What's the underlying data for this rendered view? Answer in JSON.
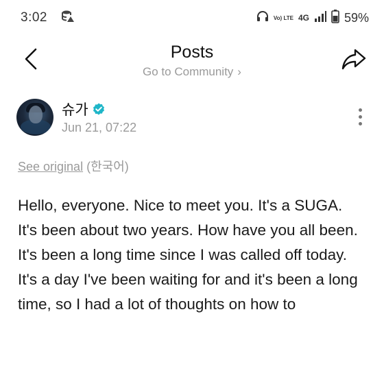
{
  "status_bar": {
    "time": "3:02",
    "volte": "Vo) LTE",
    "network": "4G",
    "battery": "59%"
  },
  "header": {
    "title": "Posts",
    "community_link": "Go to Community",
    "community_chevron": "›"
  },
  "author": {
    "name": "슈가",
    "time": "Jun 21, 07:22"
  },
  "translation": {
    "see_original": "See original",
    "language": "(한국어)"
  },
  "post": {
    "lines": [
      "Hello, everyone. Nice to meet you. It's a SUGA.",
      "It's been about two years. How have you all been.",
      "It's been a long time since I was called off today.",
      "It's a day I've been waiting for and it's been a long time, so I had a lot of thoughts on how to"
    ]
  },
  "colors": {
    "verified": "#1fb6c8",
    "muted_text": "#9a9a9a"
  }
}
